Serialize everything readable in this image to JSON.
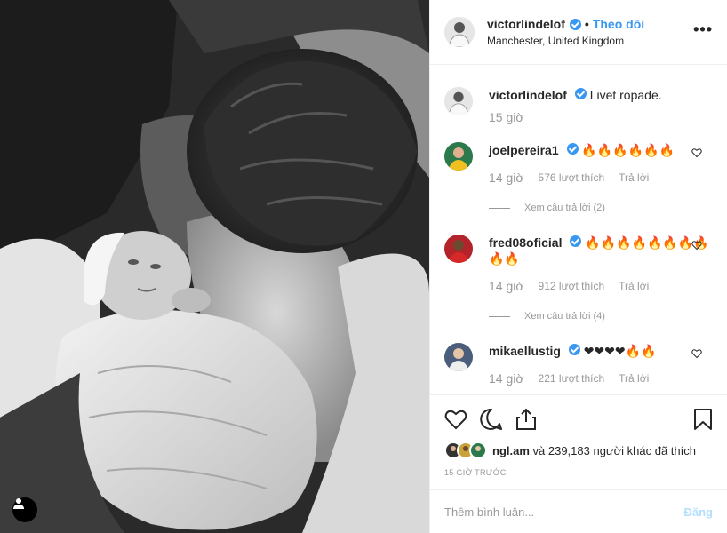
{
  "post": {
    "author": "victorlindelof",
    "follow_label": "Theo dõi",
    "separator": "•",
    "location": "Manchester, United Kingdom",
    "more_label": "•••"
  },
  "caption": {
    "user": "victorlindelof",
    "text": "Livet ropade.",
    "time": "15 giờ"
  },
  "comments": [
    {
      "user": "joelpereira1",
      "text": "🔥🔥🔥🔥🔥🔥",
      "time": "14 giờ",
      "likes": "576 lượt thích",
      "reply_label": "Trả lời",
      "view_replies": "Xem câu trả lời (2)",
      "avatar_color": "#2c7a4b"
    },
    {
      "user": "fred08oficial",
      "text": "🔥🔥🔥🔥🔥🔥🔥🔥🔥🔥",
      "time": "14 giờ",
      "likes": "912 lượt thích",
      "reply_label": "Trả lời",
      "view_replies": "Xem câu trả lời (4)",
      "avatar_color": "#b3242a"
    },
    {
      "user": "mikaellustig",
      "text": "❤❤❤❤🔥🔥",
      "time": "14 giờ",
      "likes": "221 lượt thích",
      "reply_label": "Trả lời",
      "avatar_color": "#4a5d7a"
    }
  ],
  "likes_summary": {
    "first_user": "ngl.am",
    "rest": " và 239,183 người khác đã thích"
  },
  "timestamp": "15 GIỜ TRƯỚC",
  "add_comment": {
    "placeholder": "Thêm bình luận...",
    "post_label": "Đăng"
  },
  "icons": {
    "like": "heart-icon",
    "comment": "comment-icon",
    "share": "share-icon",
    "save": "bookmark-icon",
    "user_tags": "user-icon",
    "more": "more-icon",
    "verified": "verified-badge-icon"
  },
  "colors": {
    "link": "#3897f0",
    "muted": "#999999",
    "border": "#efefef",
    "post_disabled": "#b2dffc"
  }
}
